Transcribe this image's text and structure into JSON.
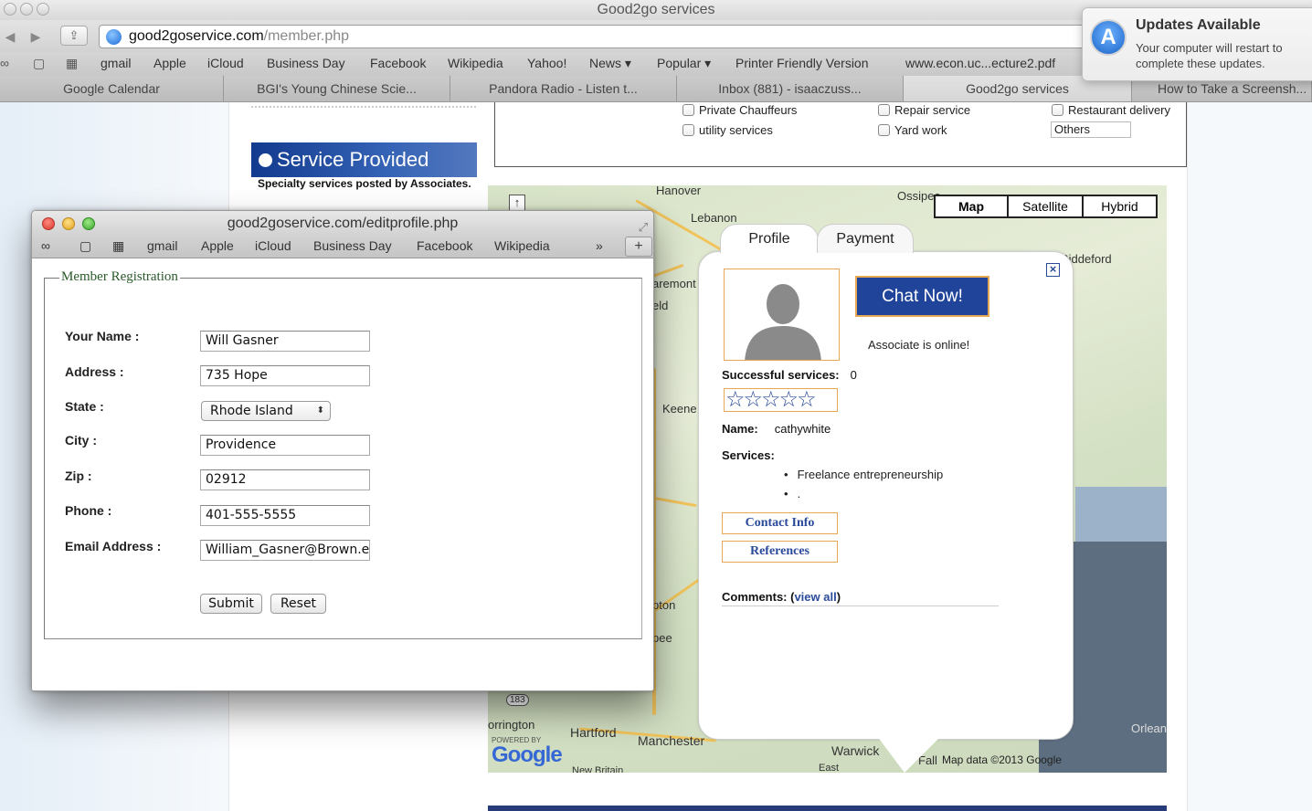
{
  "window": {
    "title": "Good2go services"
  },
  "toolbar": {
    "url_domain": "good2goservice.com",
    "url_path": "/member.php"
  },
  "bookmarks": [
    "gmail",
    "Apple",
    "iCloud",
    "Business Day",
    "Facebook",
    "Wikipedia",
    "Yahoo!",
    "News ▾",
    "Popular ▾",
    "Printer Friendly Version",
    "www.econ.uc...ecture2.pdf"
  ],
  "tabs": [
    "Google Calendar",
    "BGI's Young Chinese Scie...",
    "Pandora Radio - Listen t...",
    "Inbox (881) - isaaczuss...",
    "Good2go services",
    "How to Take a Screensh..."
  ],
  "notification": {
    "title": "Updates Available",
    "body": "Your computer will restart to complete these updates."
  },
  "checkboxes": [
    "Private Chauffeurs",
    "utility services",
    "Repair service",
    "Yard work",
    "Restaurant delivery"
  ],
  "others_value": "Others",
  "service": {
    "heading": "Service Provided",
    "subtitle": "Specialty services posted by Associates."
  },
  "map": {
    "types": [
      "Map",
      "Satellite",
      "Hybrid"
    ],
    "labels": [
      "Hanover",
      "Lebanon",
      "Ossipee",
      "Biddeford",
      "aremont",
      "eld",
      "Keene",
      "pton",
      "pee",
      "orrington",
      "Hartford",
      "Manchester",
      "Warwick",
      "Fall",
      "East",
      "Orlean",
      "New Britain"
    ],
    "route_markers": [
      "183"
    ],
    "powered_by": "POWERED BY",
    "google": "Google",
    "copyright": "Map data ©2013 Google"
  },
  "profile": {
    "tabs": [
      "Profile",
      "Payment"
    ],
    "chat_label": "Chat Now!",
    "status": "Associate is online!",
    "successful_label": "Successful services:",
    "successful_value": "0",
    "stars": "☆☆☆☆☆",
    "name_label": "Name:",
    "name_value": "cathywhite",
    "services_label": "Services:",
    "services": [
      "Freelance entrepreneurship",
      "."
    ],
    "contact_label": "Contact Info",
    "references_label": "References",
    "comments_label": "Comments: (",
    "view_all": "view all",
    "comments_end": ")"
  },
  "popup": {
    "title": "good2goservice.com/editprofile.php",
    "bookmarks": [
      "gmail",
      "Apple",
      "iCloud",
      "Business Day",
      "Facebook",
      "Wikipedia"
    ],
    "legend": "Member Registration",
    "fields": [
      {
        "label": "Your Name :",
        "value": "Will Gasner"
      },
      {
        "label": "Address :",
        "value": "735 Hope"
      },
      {
        "label": "State :",
        "value": "Rhode Island"
      },
      {
        "label": "City :",
        "value": "Providence"
      },
      {
        "label": "Zip :",
        "value": "02912"
      },
      {
        "label": "Phone :",
        "value": "401-555-5555"
      },
      {
        "label": "Email Address :",
        "value": "William_Gasner@Brown.edu"
      }
    ],
    "submit_label": "Submit",
    "reset_label": "Reset"
  },
  "colors": {
    "accent": "#21449b",
    "orange_border": "#e6a854",
    "link": "#2a4a9a"
  }
}
